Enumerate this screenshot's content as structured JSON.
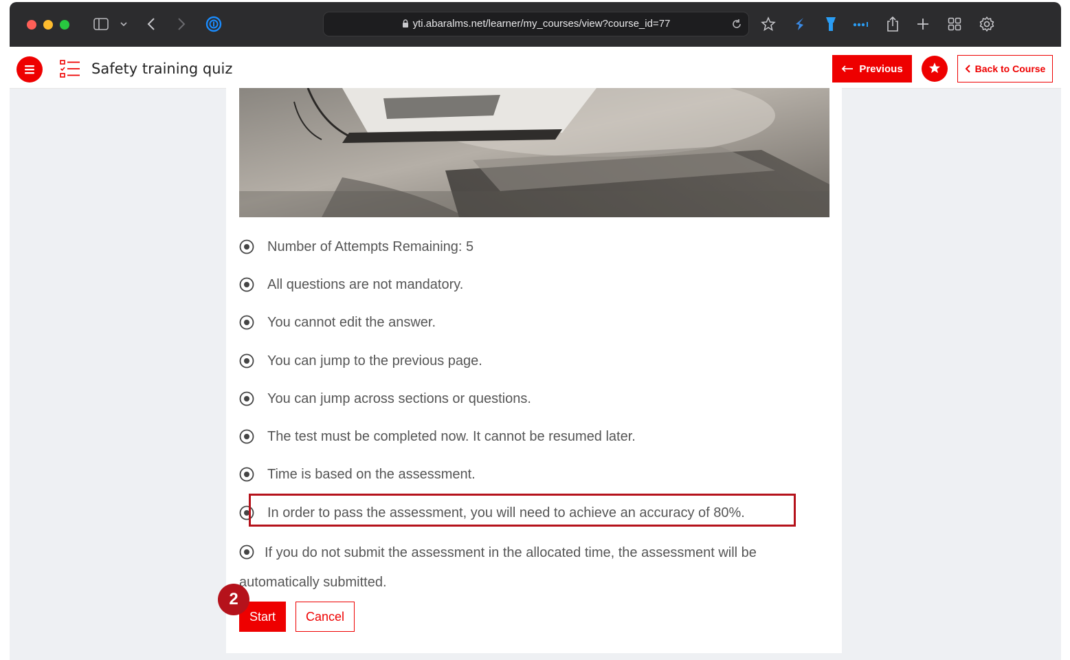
{
  "browser": {
    "url": "yti.abaralms.net/learner/my_courses/view?course_id=77"
  },
  "header": {
    "title": "Safety training quiz",
    "previous_label": "Previous",
    "back_label": "Back to Course"
  },
  "rules": [
    "Number of Attempts Remaining: 5",
    "All questions are not mandatory.",
    "You cannot edit the answer.",
    "You can jump to the previous page.",
    "You can jump across sections or questions.",
    "The test must be completed now. It cannot be resumed later.",
    "Time is based on the assessment.",
    "In order to pass the assessment, you will need to achieve an accuracy of 80%.",
    "If you do not submit the assessment in the allocated time, the assessment will be automatically submitted."
  ],
  "actions": {
    "start_label": "Start",
    "cancel_label": "Cancel"
  },
  "annotation": {
    "step_number": "2"
  },
  "colors": {
    "accent": "#ee0000",
    "highlight": "#b5121b",
    "text": "#555555"
  }
}
